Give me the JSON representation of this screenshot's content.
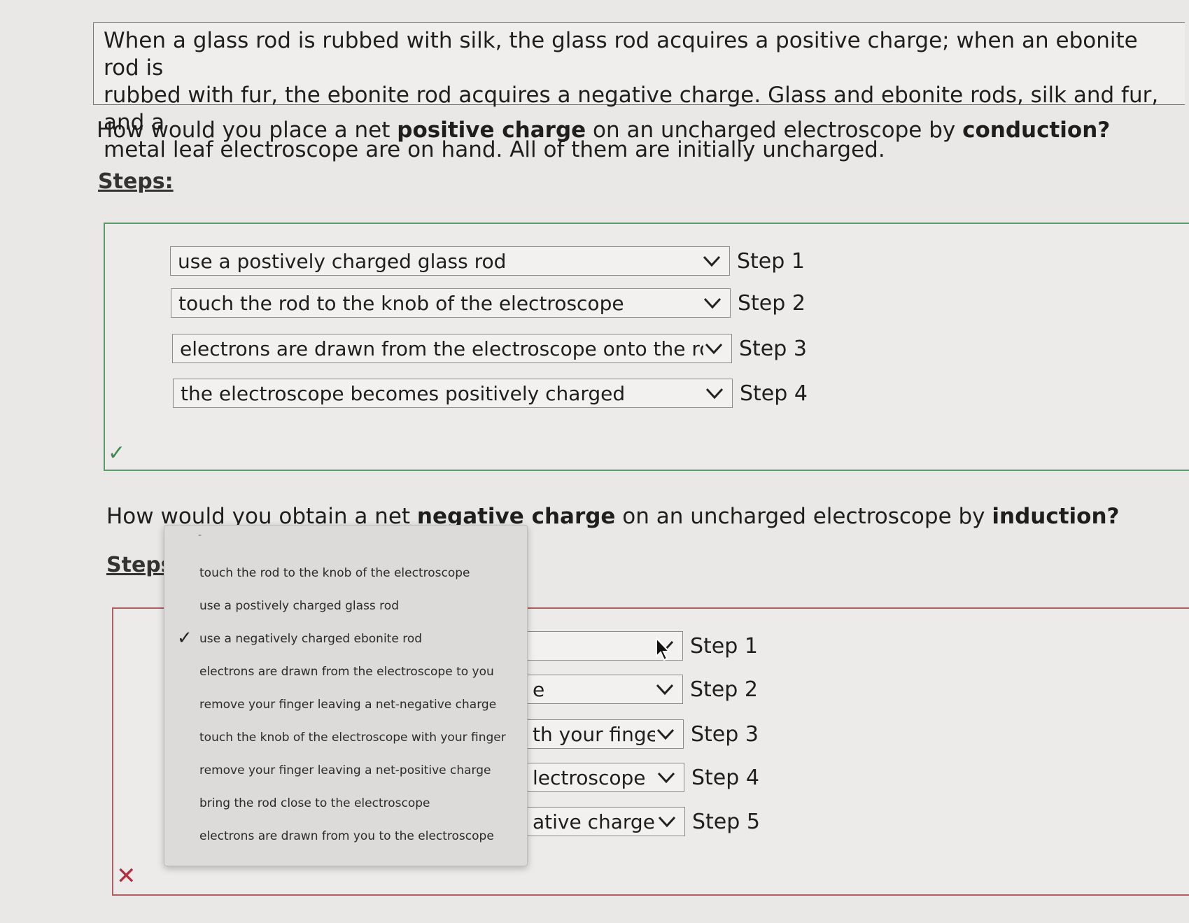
{
  "intro": {
    "line1": "When a glass rod is rubbed with silk, the glass rod acquires a positive charge; when an ebonite rod is",
    "line2": "rubbed with fur, the ebonite rod acquires a negative charge. Glass and ebonite rods, silk and fur, and a",
    "line3": "metal leaf electroscope are on hand. All of them are initially uncharged."
  },
  "q1": {
    "pre": "How would you place a net ",
    "bold1": "positive charge",
    "mid": " on an uncharged electroscope by ",
    "bold2": "conduction?",
    "steps_label": "Steps:",
    "rows": [
      {
        "value": "use a postively charged glass rod",
        "step": "Step 1"
      },
      {
        "value": "touch the rod to the knob of the electroscope",
        "step": "Step 2"
      },
      {
        "value": "electrons are drawn from the electroscope onto the rod",
        "step": "Step 3"
      },
      {
        "value": "the electroscope becomes positively charged",
        "step": "Step 4"
      }
    ],
    "result_icon": "check-icon",
    "result_color": "#3f8a4f"
  },
  "q2": {
    "pre": "How would you obtain a net ",
    "bold1": "negative charge",
    "mid": " on an uncharged electroscope by ",
    "bold2": "induction?",
    "steps_label": "Steps",
    "rows": [
      {
        "value": "",
        "step": "Step 1"
      },
      {
        "value": "e",
        "step": "Step 2"
      },
      {
        "value": "th your finger",
        "step": "Step 3"
      },
      {
        "value": "lectroscope",
        "step": "Step 4"
      },
      {
        "value": "ative charge",
        "step": "Step 5"
      }
    ],
    "result_icon": "x-icon",
    "result_color": "#b03040"
  },
  "dropdown": {
    "placeholder": "-",
    "selected_index": 2,
    "options": [
      "touch the rod to the knob of the electroscope",
      "use a postively charged glass rod",
      "use a negatively charged ebonite rod",
      "electrons are drawn from the electroscope to you",
      "remove your finger leaving a net-negative charge",
      "touch the knob of the electroscope with your finger",
      "remove your finger leaving a net-positive charge",
      "bring the rod close to the electroscope",
      "electrons are drawn from you to the electroscope"
    ]
  }
}
